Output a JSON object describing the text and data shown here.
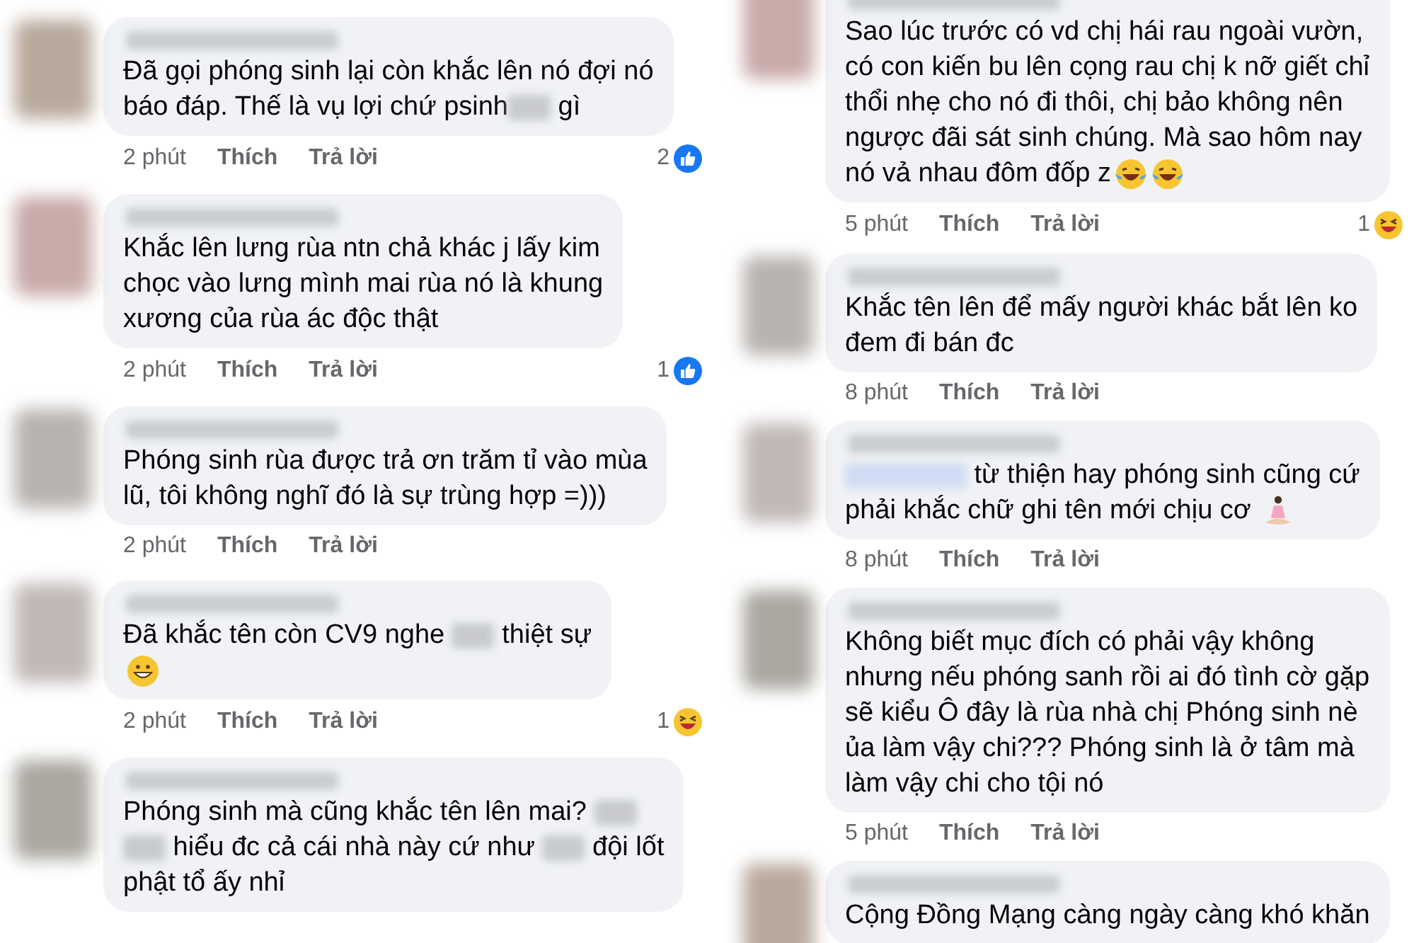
{
  "columns": [
    {
      "comments": [
        {
          "body": [
            {
              "kind": "text",
              "text": "Đã gọi phóng sinh lại còn khắc lên nó đợi nó\nbáo đáp. Thế là vụ lợi chứ psinh"
            },
            {
              "kind": "redacted"
            },
            {
              "kind": "text",
              "text": " gì"
            }
          ],
          "time": "2 phút",
          "like": "Thích",
          "reply": "Trả lời",
          "reaction": {
            "count": "2",
            "kind": "like"
          }
        },
        {
          "body": [
            {
              "kind": "text",
              "text": "Khắc lên lưng rùa ntn chả khác j lấy kim\nchọc vào lưng mình mai rùa nó là khung\nxương của rùa ác độc thật"
            }
          ],
          "time": "2 phút",
          "like": "Thích",
          "reply": "Trả lời",
          "reaction": {
            "count": "1",
            "kind": "like"
          }
        },
        {
          "body": [
            {
              "kind": "text",
              "text": "Phóng sinh rùa được trả ơn trăm tỉ vào mùa\nlũ, tôi không nghĩ đó là sự trùng hợp =)))"
            }
          ],
          "time": "2 phút",
          "like": "Thích",
          "reply": "Trả lời"
        },
        {
          "body": [
            {
              "kind": "text",
              "text": "Đã khắc tên còn CV9 nghe "
            },
            {
              "kind": "redacted"
            },
            {
              "kind": "text",
              "text": " thiệt sự"
            },
            {
              "kind": "break"
            },
            {
              "kind": "grin"
            }
          ],
          "time": "2 phút",
          "like": "Thích",
          "reply": "Trả lời",
          "reaction": {
            "count": "1",
            "kind": "haha"
          }
        },
        {
          "body": [
            {
              "kind": "text",
              "text": "Phóng sinh mà cũng khắc tên lên mai? "
            },
            {
              "kind": "redacted"
            },
            {
              "kind": "break"
            },
            {
              "kind": "redacted"
            },
            {
              "kind": "text",
              "text": " hiểu đc cả cái nhà này cứ như "
            },
            {
              "kind": "redacted"
            },
            {
              "kind": "text",
              "text": " đội lốt\nphật tổ ấy nhỉ"
            }
          ]
        }
      ]
    },
    {
      "comments": [
        {
          "body": [
            {
              "kind": "text",
              "text": "Sao lúc trước có vd chị hái rau ngoài vườn,\ncó con kiến bu lên cọng rau chị k nỡ giết chỉ\nthổi nhẹ cho nó đi thôi, chị bảo không nên\nngược đãi sát sinh chúng. Mà sao hôm nay\nnó vả nhau đôm đốp z"
            },
            {
              "kind": "tears"
            },
            {
              "kind": "tears"
            }
          ],
          "time": "5 phút",
          "like": "Thích",
          "reply": "Trả lời",
          "reaction": {
            "count": "1",
            "kind": "haha"
          }
        },
        {
          "body": [
            {
              "kind": "text",
              "text": "Khắc tên lên để mấy người khác bắt lên ko\nđem đi bán đc"
            }
          ],
          "time": "8 phút",
          "like": "Thích",
          "reply": "Trả lời"
        },
        {
          "body": [
            {
              "kind": "tag"
            },
            {
              "kind": "text",
              "text": " từ thiện hay phóng sinh cũng cứ\nphải khắc chữ ghi tên mới chịu cơ "
            },
            {
              "kind": "meditate"
            }
          ],
          "time": "8 phút",
          "like": "Thích",
          "reply": "Trả lời"
        },
        {
          "body": [
            {
              "kind": "text",
              "text": "Không biết mục đích có phải vậy không\nnhưng nếu phóng sanh rồi ai đó tình cờ gặp\nsẽ kiểu Ô đây là rùa nhà chị Phóng sinh nè\nủa làm vậy chi??? Phóng sinh là ở tâm mà\nlàm vậy chi cho tội nó"
            }
          ],
          "time": "5 phút",
          "like": "Thích",
          "reply": "Trả lời"
        },
        {
          "body": [
            {
              "kind": "text",
              "text": "Cộng Đồng Mạng càng ngày càng khó khăn"
            }
          ]
        }
      ]
    }
  ]
}
